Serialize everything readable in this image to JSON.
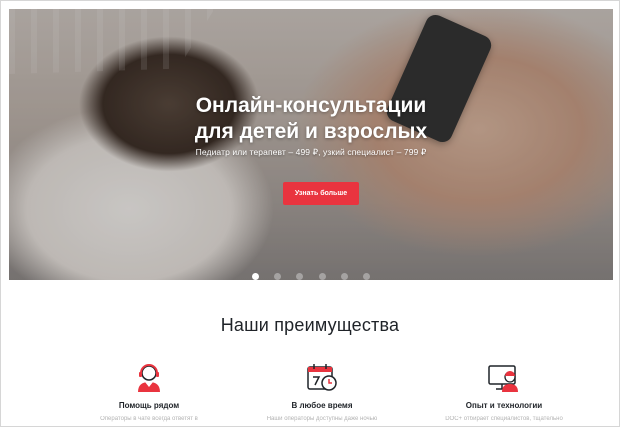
{
  "hero": {
    "title_line1": "Онлайн-консультации",
    "title_line2": "для детей и взрослых",
    "subtitle": "Педиатр или терапевт – 499 ₽, узкий специалист – 799 ₽",
    "button_label": "Узнать больше",
    "slides_total": 6,
    "active_slide": 1
  },
  "advantages": {
    "title": "Наши преимущества",
    "items": [
      {
        "icon": "operator-icon",
        "title": "Помощь рядом",
        "desc": "Операторы в чате всегда ответят в"
      },
      {
        "icon": "calendar-clock-icon",
        "title": "В любое время",
        "desc": "Наши операторы доступны даже ночью"
      },
      {
        "icon": "doctor-monitor-icon",
        "title": "Опыт и технологии",
        "desc": "DOC+ отбирает специалистов, тщательно"
      }
    ]
  },
  "colors": {
    "accent": "#e9343f",
    "text_dark": "#1f2328",
    "text_muted": "#b3b3b3"
  }
}
